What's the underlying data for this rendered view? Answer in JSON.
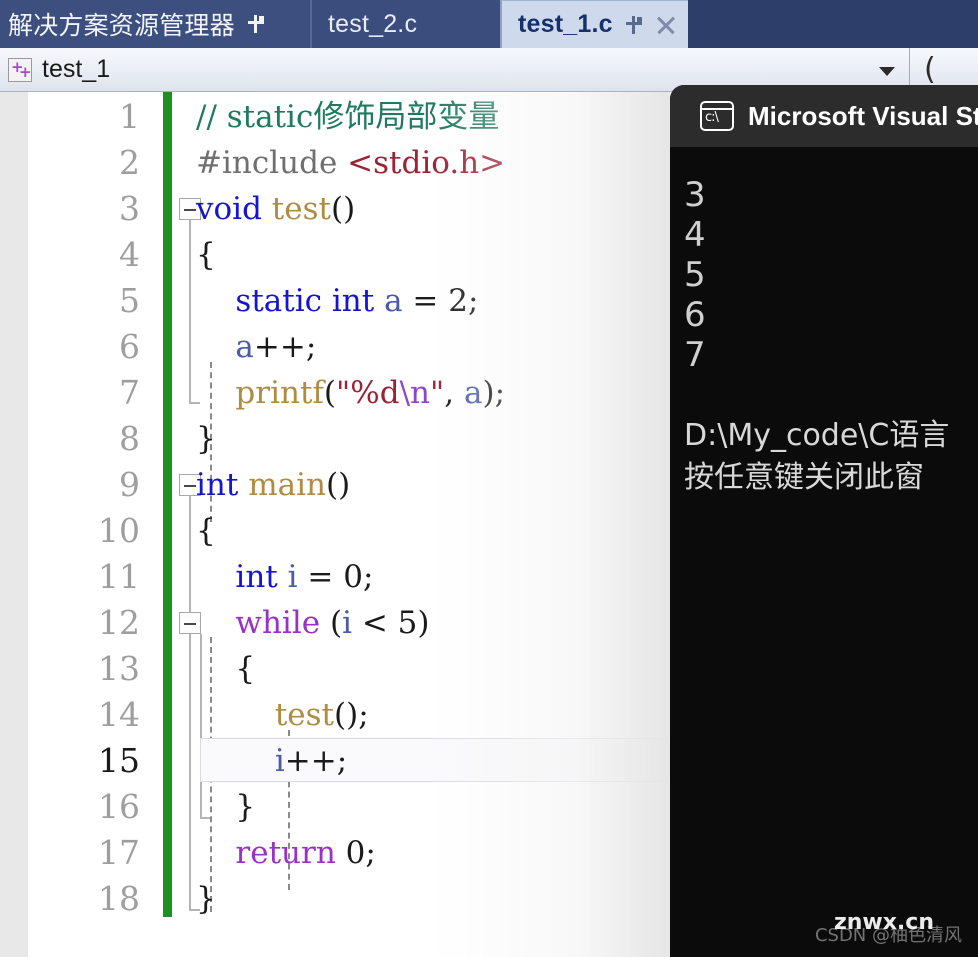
{
  "tabstrip": {
    "docwell_label": "解决方案资源管理器",
    "docwell_pin_icon": "pin-icon",
    "tabs": [
      {
        "label": "test_2.c",
        "active": false
      },
      {
        "label": "test_1.c",
        "active": true,
        "pin_icon": "pin-icon",
        "close_icon": "close-icon"
      }
    ]
  },
  "navbar": {
    "project_icon": "cpp-project-icon",
    "icon_plus_1": "+",
    "icon_plus_2": "+",
    "scope_value": "test_1",
    "dropdown_icon": "chevron-down-icon",
    "right_glyph": "("
  },
  "editor": {
    "current_line": 15,
    "lines": [
      {
        "n": "1",
        "tokens": [
          {
            "t": "// static修饰局部变量",
            "c": "hl-comment"
          }
        ]
      },
      {
        "n": "2",
        "tokens": [
          {
            "t": "#include ",
            "c": "hl-pp"
          },
          {
            "t": "<stdio.h>",
            "c": "hl-hdr"
          }
        ]
      },
      {
        "n": "3",
        "tokens": [
          {
            "t": "void ",
            "c": "hl-kw"
          },
          {
            "t": "test",
            "c": "hl-fn"
          },
          {
            "t": "()",
            "c": "hl-plain"
          }
        ]
      },
      {
        "n": "4",
        "tokens": [
          {
            "t": "{",
            "c": "hl-plain"
          }
        ]
      },
      {
        "n": "5",
        "tokens": [
          {
            "t": "    ",
            "c": "hl-plain"
          },
          {
            "t": "static int ",
            "c": "hl-kw"
          },
          {
            "t": "a",
            "c": "hl-var"
          },
          {
            "t": " = ",
            "c": "hl-plain"
          },
          {
            "t": "2",
            "c": "hl-num"
          },
          {
            "t": ";",
            "c": "hl-plain"
          }
        ]
      },
      {
        "n": "6",
        "tokens": [
          {
            "t": "    ",
            "c": "hl-plain"
          },
          {
            "t": "a",
            "c": "hl-var"
          },
          {
            "t": "++;",
            "c": "hl-plain"
          }
        ]
      },
      {
        "n": "7",
        "tokens": [
          {
            "t": "    ",
            "c": "hl-plain"
          },
          {
            "t": "printf",
            "c": "hl-fn"
          },
          {
            "t": "(",
            "c": "hl-plain"
          },
          {
            "t": "\"%d",
            "c": "hl-str"
          },
          {
            "t": "\\n",
            "c": "hl-esc"
          },
          {
            "t": "\"",
            "c": "hl-str"
          },
          {
            "t": ", ",
            "c": "hl-plain"
          },
          {
            "t": "a",
            "c": "hl-var"
          },
          {
            "t": ");",
            "c": "hl-plain"
          }
        ]
      },
      {
        "n": "8",
        "tokens": [
          {
            "t": "}",
            "c": "hl-plain"
          }
        ]
      },
      {
        "n": "9",
        "tokens": [
          {
            "t": "int ",
            "c": "hl-kw"
          },
          {
            "t": "main",
            "c": "hl-fn"
          },
          {
            "t": "()",
            "c": "hl-plain"
          }
        ]
      },
      {
        "n": "10",
        "tokens": [
          {
            "t": "{",
            "c": "hl-plain"
          }
        ]
      },
      {
        "n": "11",
        "tokens": [
          {
            "t": "    ",
            "c": "hl-plain"
          },
          {
            "t": "int ",
            "c": "hl-kw"
          },
          {
            "t": "i",
            "c": "hl-var"
          },
          {
            "t": " = ",
            "c": "hl-plain"
          },
          {
            "t": "0",
            "c": "hl-num"
          },
          {
            "t": ";",
            "c": "hl-plain"
          }
        ]
      },
      {
        "n": "12",
        "tokens": [
          {
            "t": "    ",
            "c": "hl-plain"
          },
          {
            "t": "while",
            "c": "hl-kw2"
          },
          {
            "t": " (",
            "c": "hl-plain"
          },
          {
            "t": "i",
            "c": "hl-var"
          },
          {
            "t": " < ",
            "c": "hl-plain"
          },
          {
            "t": "5",
            "c": "hl-num"
          },
          {
            "t": ")",
            "c": "hl-plain"
          }
        ]
      },
      {
        "n": "13",
        "tokens": [
          {
            "t": "    {",
            "c": "hl-plain"
          }
        ]
      },
      {
        "n": "14",
        "tokens": [
          {
            "t": "        ",
            "c": "hl-plain"
          },
          {
            "t": "test",
            "c": "hl-fn"
          },
          {
            "t": "();",
            "c": "hl-plain"
          }
        ]
      },
      {
        "n": "15",
        "tokens": [
          {
            "t": "        ",
            "c": "hl-plain"
          },
          {
            "t": "i",
            "c": "hl-var"
          },
          {
            "t": "++;",
            "c": "hl-plain"
          }
        ]
      },
      {
        "n": "16",
        "tokens": [
          {
            "t": "    }",
            "c": "hl-plain"
          }
        ]
      },
      {
        "n": "17",
        "tokens": [
          {
            "t": "    ",
            "c": "hl-plain"
          },
          {
            "t": "return ",
            "c": "hl-kw2"
          },
          {
            "t": "0",
            "c": "hl-num"
          },
          {
            "t": ";",
            "c": "hl-plain"
          }
        ]
      },
      {
        "n": "18",
        "tokens": [
          {
            "t": "}",
            "c": "hl-plain"
          }
        ]
      }
    ]
  },
  "console": {
    "title": "Microsoft Visual Stu",
    "icon": "terminal-icon",
    "output_lines": [
      "3",
      "4",
      "5",
      "6",
      "7"
    ],
    "path_line": "D:\\My_code\\C语言",
    "prompt_line": "按任意键关闭此窗"
  },
  "watermarks": {
    "csdn": "CSDN @柚色清风",
    "site": "znwx.cn"
  },
  "colors": {
    "tab_strip_bg": "#2D3E6B",
    "tab_active_bg": "#CFD9EC",
    "tab_active_text": "#16306B",
    "change_bar": "#1E9021",
    "console_bg": "#0B0B0B",
    "console_title_bg": "#2C2C2C"
  }
}
